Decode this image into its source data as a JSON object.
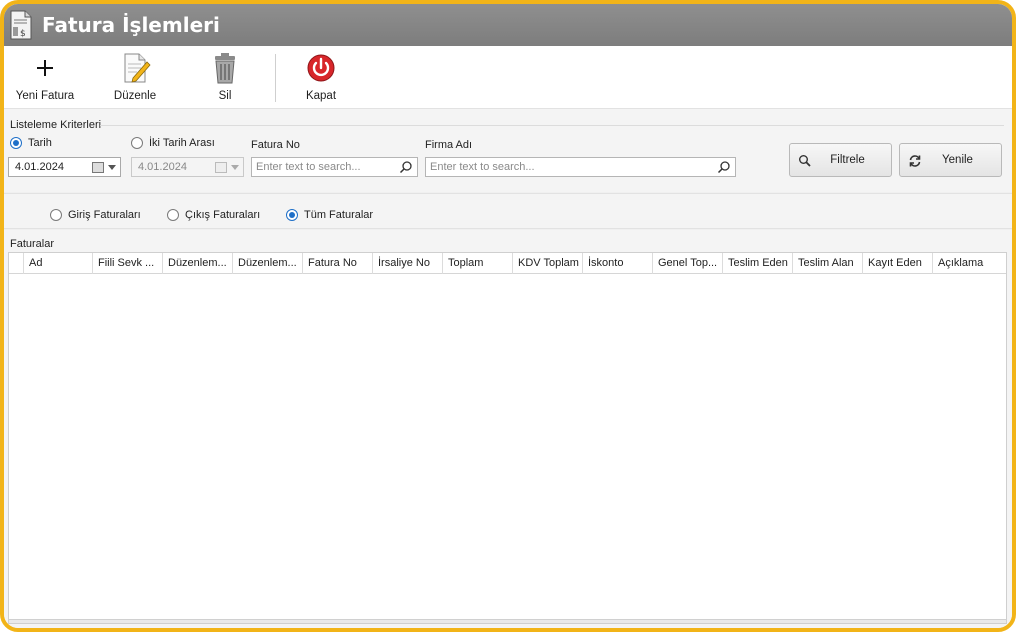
{
  "window": {
    "title": "Fatura İşlemleri",
    "accent_border": "#f2b418",
    "title_bar_color": "#858585"
  },
  "toolbar": {
    "new_label": "Yeni Fatura",
    "edit_label": "Düzenle",
    "delete_label": "Sil",
    "close_label": "Kapat"
  },
  "criteria": {
    "group_title": "Listeleme Kriterleri",
    "radio_date_label": "Tarih",
    "radio_range_label": "İki Tarih Arası",
    "date_value": "4.01.2024",
    "range_date_value": "4.01.2024",
    "invoice_no_label": "Fatura No",
    "invoice_no_placeholder": "Enter text to search...",
    "company_label": "Firma Adı",
    "company_placeholder": "Enter text to search...",
    "filter_button": "Filtrele",
    "refresh_button": "Yenile"
  },
  "invoice_type": {
    "incoming_label": "Giriş Faturaları",
    "outgoing_label": "Çıkış Faturaları",
    "all_label": "Tüm Faturalar",
    "selected": "all"
  },
  "grid": {
    "title": "Faturalar",
    "columns": [
      "Ad",
      "Fiili Sevk ...",
      "Düzenlem...",
      "Düzenlem...",
      "Fatura No",
      "İrsaliye No",
      "Toplam",
      "KDV Toplam",
      "İskonto",
      "Genel Top...",
      "Teslim Eden",
      "Teslim Alan",
      "Kayıt Eden",
      "Açıklama"
    ],
    "rows": []
  }
}
